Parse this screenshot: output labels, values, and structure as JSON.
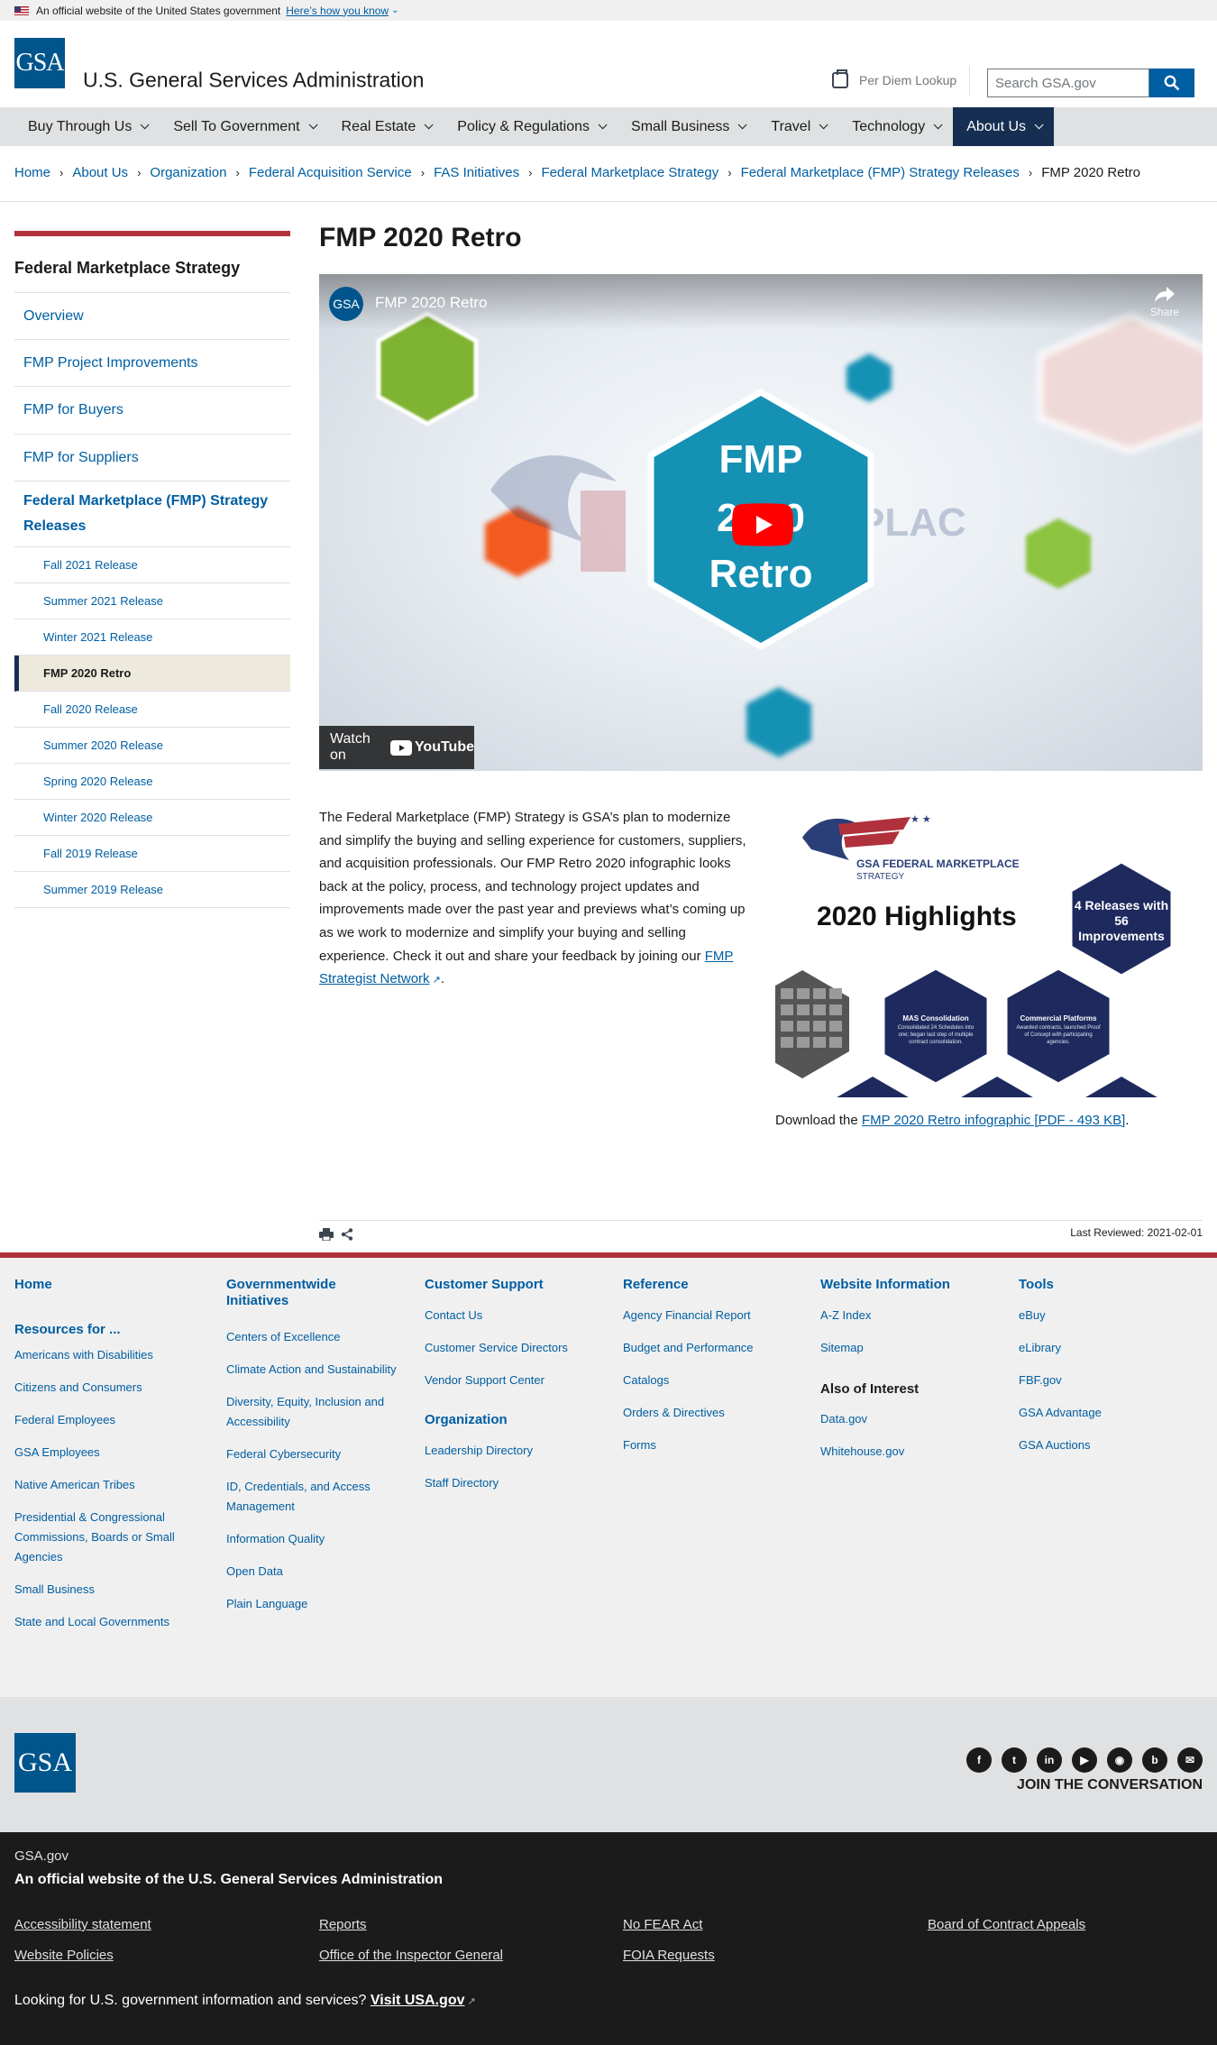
{
  "banner": {
    "text": "An official website of the United States government",
    "link": "Here’s how you know"
  },
  "header": {
    "logo": "GSA",
    "title": "U.S. General Services Administration",
    "per_diem": "Per Diem Lookup",
    "search_placeholder": "Search GSA.gov"
  },
  "nav": {
    "items": [
      {
        "label": "Buy Through Us"
      },
      {
        "label": "Sell To Government"
      },
      {
        "label": "Real Estate"
      },
      {
        "label": "Policy & Regulations"
      },
      {
        "label": "Small Business"
      },
      {
        "label": "Travel"
      },
      {
        "label": "Technology"
      },
      {
        "label": "About Us"
      }
    ],
    "active": "About Us"
  },
  "breadcrumb": [
    "Home",
    "About Us",
    "Organization",
    "Federal Acquisition Service",
    "FAS Initiatives",
    "Federal Marketplace Strategy",
    "Federal Marketplace (FMP) Strategy Releases",
    "FMP 2020 Retro"
  ],
  "sidebar": {
    "title": "Federal Marketplace Strategy",
    "top": [
      "Overview",
      "FMP Project Improvements",
      "FMP for Buyers",
      "FMP for Suppliers"
    ],
    "section": "Federal Marketplace (FMP) Strategy Releases",
    "sub": [
      "Fall 2021 Release",
      "Summer 2021 Release",
      "Winter 2021 Release",
      "FMP 2020 Retro",
      "Fall 2020 Release",
      "Summer 2020 Release",
      "Spring 2020 Release",
      "Winter 2020 Release",
      "Fall 2019 Release",
      "Summer 2019 Release"
    ],
    "current": "FMP 2020 Retro"
  },
  "page": {
    "title": "FMP 2020 Retro",
    "video": {
      "title": "FMP 2020 Retro",
      "channel": "GSA",
      "share": "Share",
      "hex_text_1": "FMP",
      "hex_text_2": "2020",
      "hex_text_3": "Retro",
      "watch_on": "Watch on",
      "youtube": "YouTube"
    },
    "body_before": "The Federal Marketplace (FMP) Strategy is GSA’s plan to modernize and simplify the buying and selling experience for customers, suppliers, and acquisition professionals. Our FMP Retro 2020 infographic looks back at the policy, process, and technology project updates and improvements made over the past year and previews what’s coming up as we work to modernize and simplify your buying and selling experience. Check it out and share your feedback by joining our ",
    "body_link": "FMP Strategist Network",
    "body_after": ".",
    "infographic": {
      "brand": "GSA FEDERAL MARKETPLACE",
      "brand_sub": "STRATEGY",
      "headline": "2020 Highlights",
      "badge": "4 Releases with 56 Improvements",
      "mas_title": "MAS Consolidation",
      "mas_text": "Consolidated 24 Schedules into one; began last step of multiple contract consolidation.",
      "cp_title": "Commercial Platforms",
      "cp_text": "Awarded contracts, launched Proof of Concept with participating agencies."
    },
    "download_prefix": "Download the ",
    "download_link": "FMP 2020 Retro infographic [PDF - 493 KB]",
    "download_suffix": ".",
    "last_reviewed": "Last Reviewed: 2021-02-01"
  },
  "footer": {
    "home": "Home",
    "resources_title": "Resources for ...",
    "resources": [
      "Americans with Disabilities",
      "Citizens and Consumers",
      "Federal Employees",
      "GSA Employees",
      "Native American Tribes",
      "Presidential & Congressional Commissions, Boards or Small Agencies",
      "Small Business",
      "State and Local Governments"
    ],
    "gov_title": "Governmentwide Initiatives",
    "gov": [
      "Centers of Excellence",
      "Climate Action and Sustainability",
      "Diversity, Equity, Inclusion and Accessibility",
      "Federal Cybersecurity",
      "ID, Credentials, and Access Management",
      "Information Quality",
      "Open Data",
      "Plain Language"
    ],
    "support_title": "Customer Support",
    "support": [
      "Contact Us",
      "Customer Service Directors",
      "Vendor Support Center"
    ],
    "org_title": "Organization",
    "org": [
      "Leadership Directory",
      "Staff Directory"
    ],
    "ref_title": "Reference",
    "ref": [
      "Agency Financial Report",
      "Budget and Performance",
      "Catalogs",
      "Orders & Directives",
      "Forms"
    ],
    "web_title": "Website Information",
    "web": [
      "A-Z Index",
      "Sitemap"
    ],
    "also_title": "Also of Interest",
    "also": [
      "Data.gov",
      "Whitehouse.gov"
    ],
    "tools_title": "Tools",
    "tools": [
      "eBuy",
      "eLibrary",
      "FBF.gov",
      "GSA Advantage",
      "GSA Auctions"
    ],
    "logo": "GSA",
    "social": [
      "facebook-icon",
      "twitter-icon",
      "linkedin-icon",
      "youtube-icon",
      "instagram-icon",
      "blog-icon",
      "email-icon"
    ],
    "join": "JOIN THE CONVERSATION"
  },
  "identifier": {
    "domain": "GSA.gov",
    "official": "An official website of the U.S. General Services Administration",
    "links": [
      "Accessibility statement",
      "Reports",
      "No FEAR Act",
      "Board of Contract Appeals",
      "Website Policies",
      "Office of the Inspector General",
      "FOIA Requests"
    ],
    "usa_prefix": "Looking for U.S. government information and services? ",
    "usa_link": "Visit USA.gov"
  }
}
